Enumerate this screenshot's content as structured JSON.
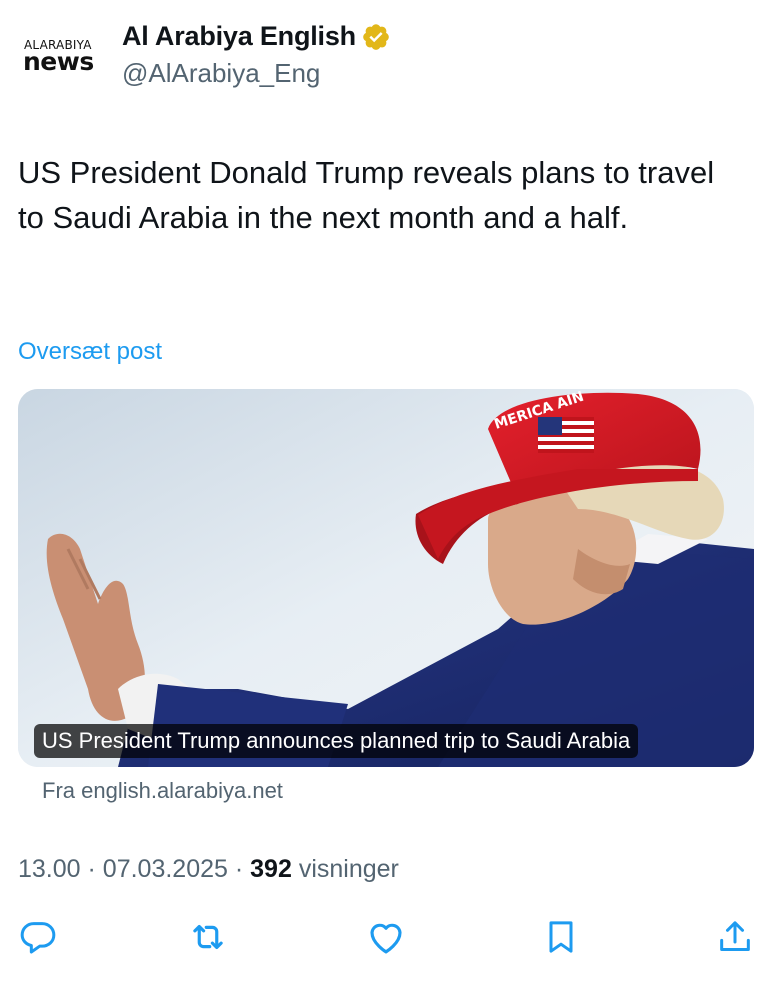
{
  "account": {
    "logo_top": "ALARABIYA",
    "logo_bottom": "news",
    "display_name": "Al Arabiya English",
    "handle": "@AlArabiya_Eng",
    "verified_icon": "verified-badge-icon",
    "verified_color": "#e2b719"
  },
  "post": {
    "text": "US President Donald Trump reveals plans to travel to Saudi Arabia in the next month and a half.",
    "translate_label": "Oversæt post"
  },
  "card": {
    "caption": "US President Trump announces planned trip to Saudi Arabia",
    "source": "Fra english.alarabiya.net",
    "hat_text": "MERICA AIN"
  },
  "meta": {
    "time": "13.00",
    "date": "07.03.2025",
    "separator": "·",
    "views_count": "392",
    "views_label": "visninger"
  },
  "actions": [
    {
      "name": "reply",
      "icon": "reply-icon"
    },
    {
      "name": "repost",
      "icon": "repost-icon"
    },
    {
      "name": "like",
      "icon": "like-icon"
    },
    {
      "name": "bookmark",
      "icon": "bookmark-icon"
    },
    {
      "name": "share",
      "icon": "share-icon"
    }
  ],
  "colors": {
    "link": "#1d9bf0",
    "secondary_text": "#536471",
    "primary_text": "#0f1419"
  }
}
